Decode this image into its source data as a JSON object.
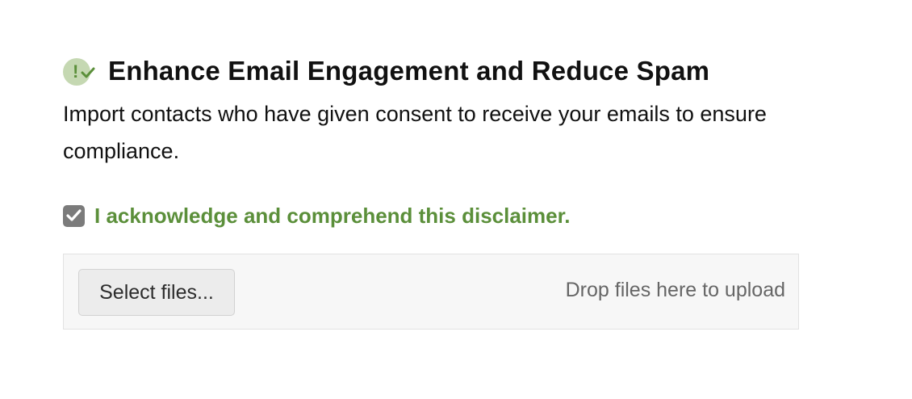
{
  "header": {
    "icon": "consent-check-icon",
    "icon_glyph": "!",
    "title": "Enhance Email Engagement and Reduce Spam"
  },
  "description": "Import contacts who have given consent to receive your emails to ensure compliance.",
  "acknowledgement": {
    "checked": true,
    "label": "I acknowledge and comprehend this disclaimer."
  },
  "upload": {
    "select_button_label": "Select files...",
    "drop_hint": "Drop files here to upload"
  },
  "colors": {
    "accent_green": "#5b8f3a",
    "badge_bg": "#c5d8b2",
    "checkbox_bg": "#7b7b7b"
  }
}
